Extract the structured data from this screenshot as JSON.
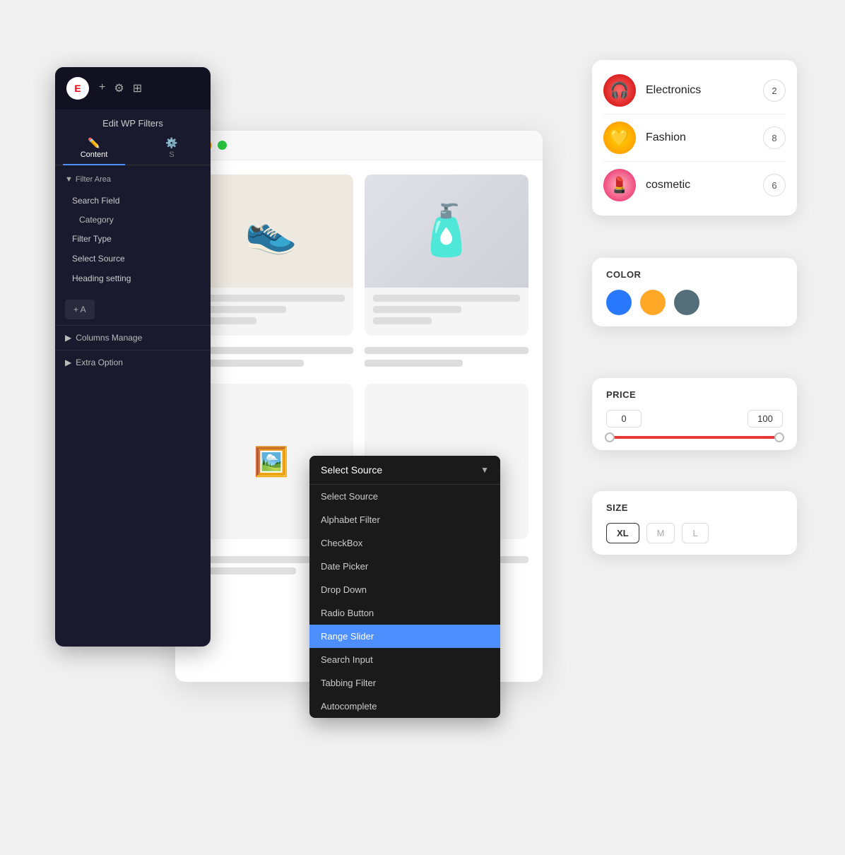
{
  "sidebar": {
    "title": "Edit WP Filters",
    "tabs": [
      {
        "label": "Content",
        "icon": "✏️",
        "active": true
      },
      {
        "label": "S",
        "icon": "⚙️",
        "active": false
      }
    ],
    "filter_area_label": "Filter Area",
    "search_field_label": "Search Field",
    "rows": [
      {
        "label": "Category"
      },
      {
        "label": "Filter Type"
      },
      {
        "label": "Select Source"
      },
      {
        "label": "Heading setting"
      }
    ],
    "add_btn": "+ A",
    "collapse_items": [
      {
        "label": "Columns Manage"
      },
      {
        "label": "Extra Option"
      }
    ]
  },
  "titlebar": {
    "dot_red": "close",
    "dot_yellow": "minimize",
    "dot_green": "maximize"
  },
  "categories": [
    {
      "name": "Electronics",
      "count": "2",
      "emoji": "🎧",
      "bg": "electronics"
    },
    {
      "name": "Fashion",
      "count": "8",
      "emoji": "💛",
      "bg": "fashion"
    },
    {
      "name": "cosmetic",
      "count": "6",
      "emoji": "💄",
      "bg": "cosmetic"
    }
  ],
  "color_section": {
    "label": "COLOR",
    "swatches": [
      {
        "color": "blue",
        "hex": "#2979ff"
      },
      {
        "color": "orange",
        "hex": "#ffa726"
      },
      {
        "color": "gray",
        "hex": "#546e7a"
      }
    ]
  },
  "price_section": {
    "label": "PRICE",
    "min": "0",
    "max": "100"
  },
  "size_section": {
    "label": "SIZE",
    "options": [
      {
        "label": "XL",
        "active": true
      },
      {
        "label": "M",
        "active": false
      },
      {
        "label": "L",
        "active": false
      }
    ]
  },
  "dropdown": {
    "header": "Select Source",
    "items": [
      {
        "label": "Select Source",
        "selected": false
      },
      {
        "label": "Alphabet Filter",
        "selected": false
      },
      {
        "label": "CheckBox",
        "selected": false
      },
      {
        "label": "Date Picker",
        "selected": false
      },
      {
        "label": "Drop Down",
        "selected": false
      },
      {
        "label": "Radio Button",
        "selected": false
      },
      {
        "label": "Range Slider",
        "selected": true
      },
      {
        "label": "Search Input",
        "selected": false
      },
      {
        "label": "Tabbing Filter",
        "selected": false
      },
      {
        "label": "Autocomplete",
        "selected": false
      }
    ]
  },
  "products": [
    {
      "type": "shoes",
      "emoji": "👟"
    },
    {
      "type": "bottle",
      "emoji": "🧴"
    }
  ]
}
